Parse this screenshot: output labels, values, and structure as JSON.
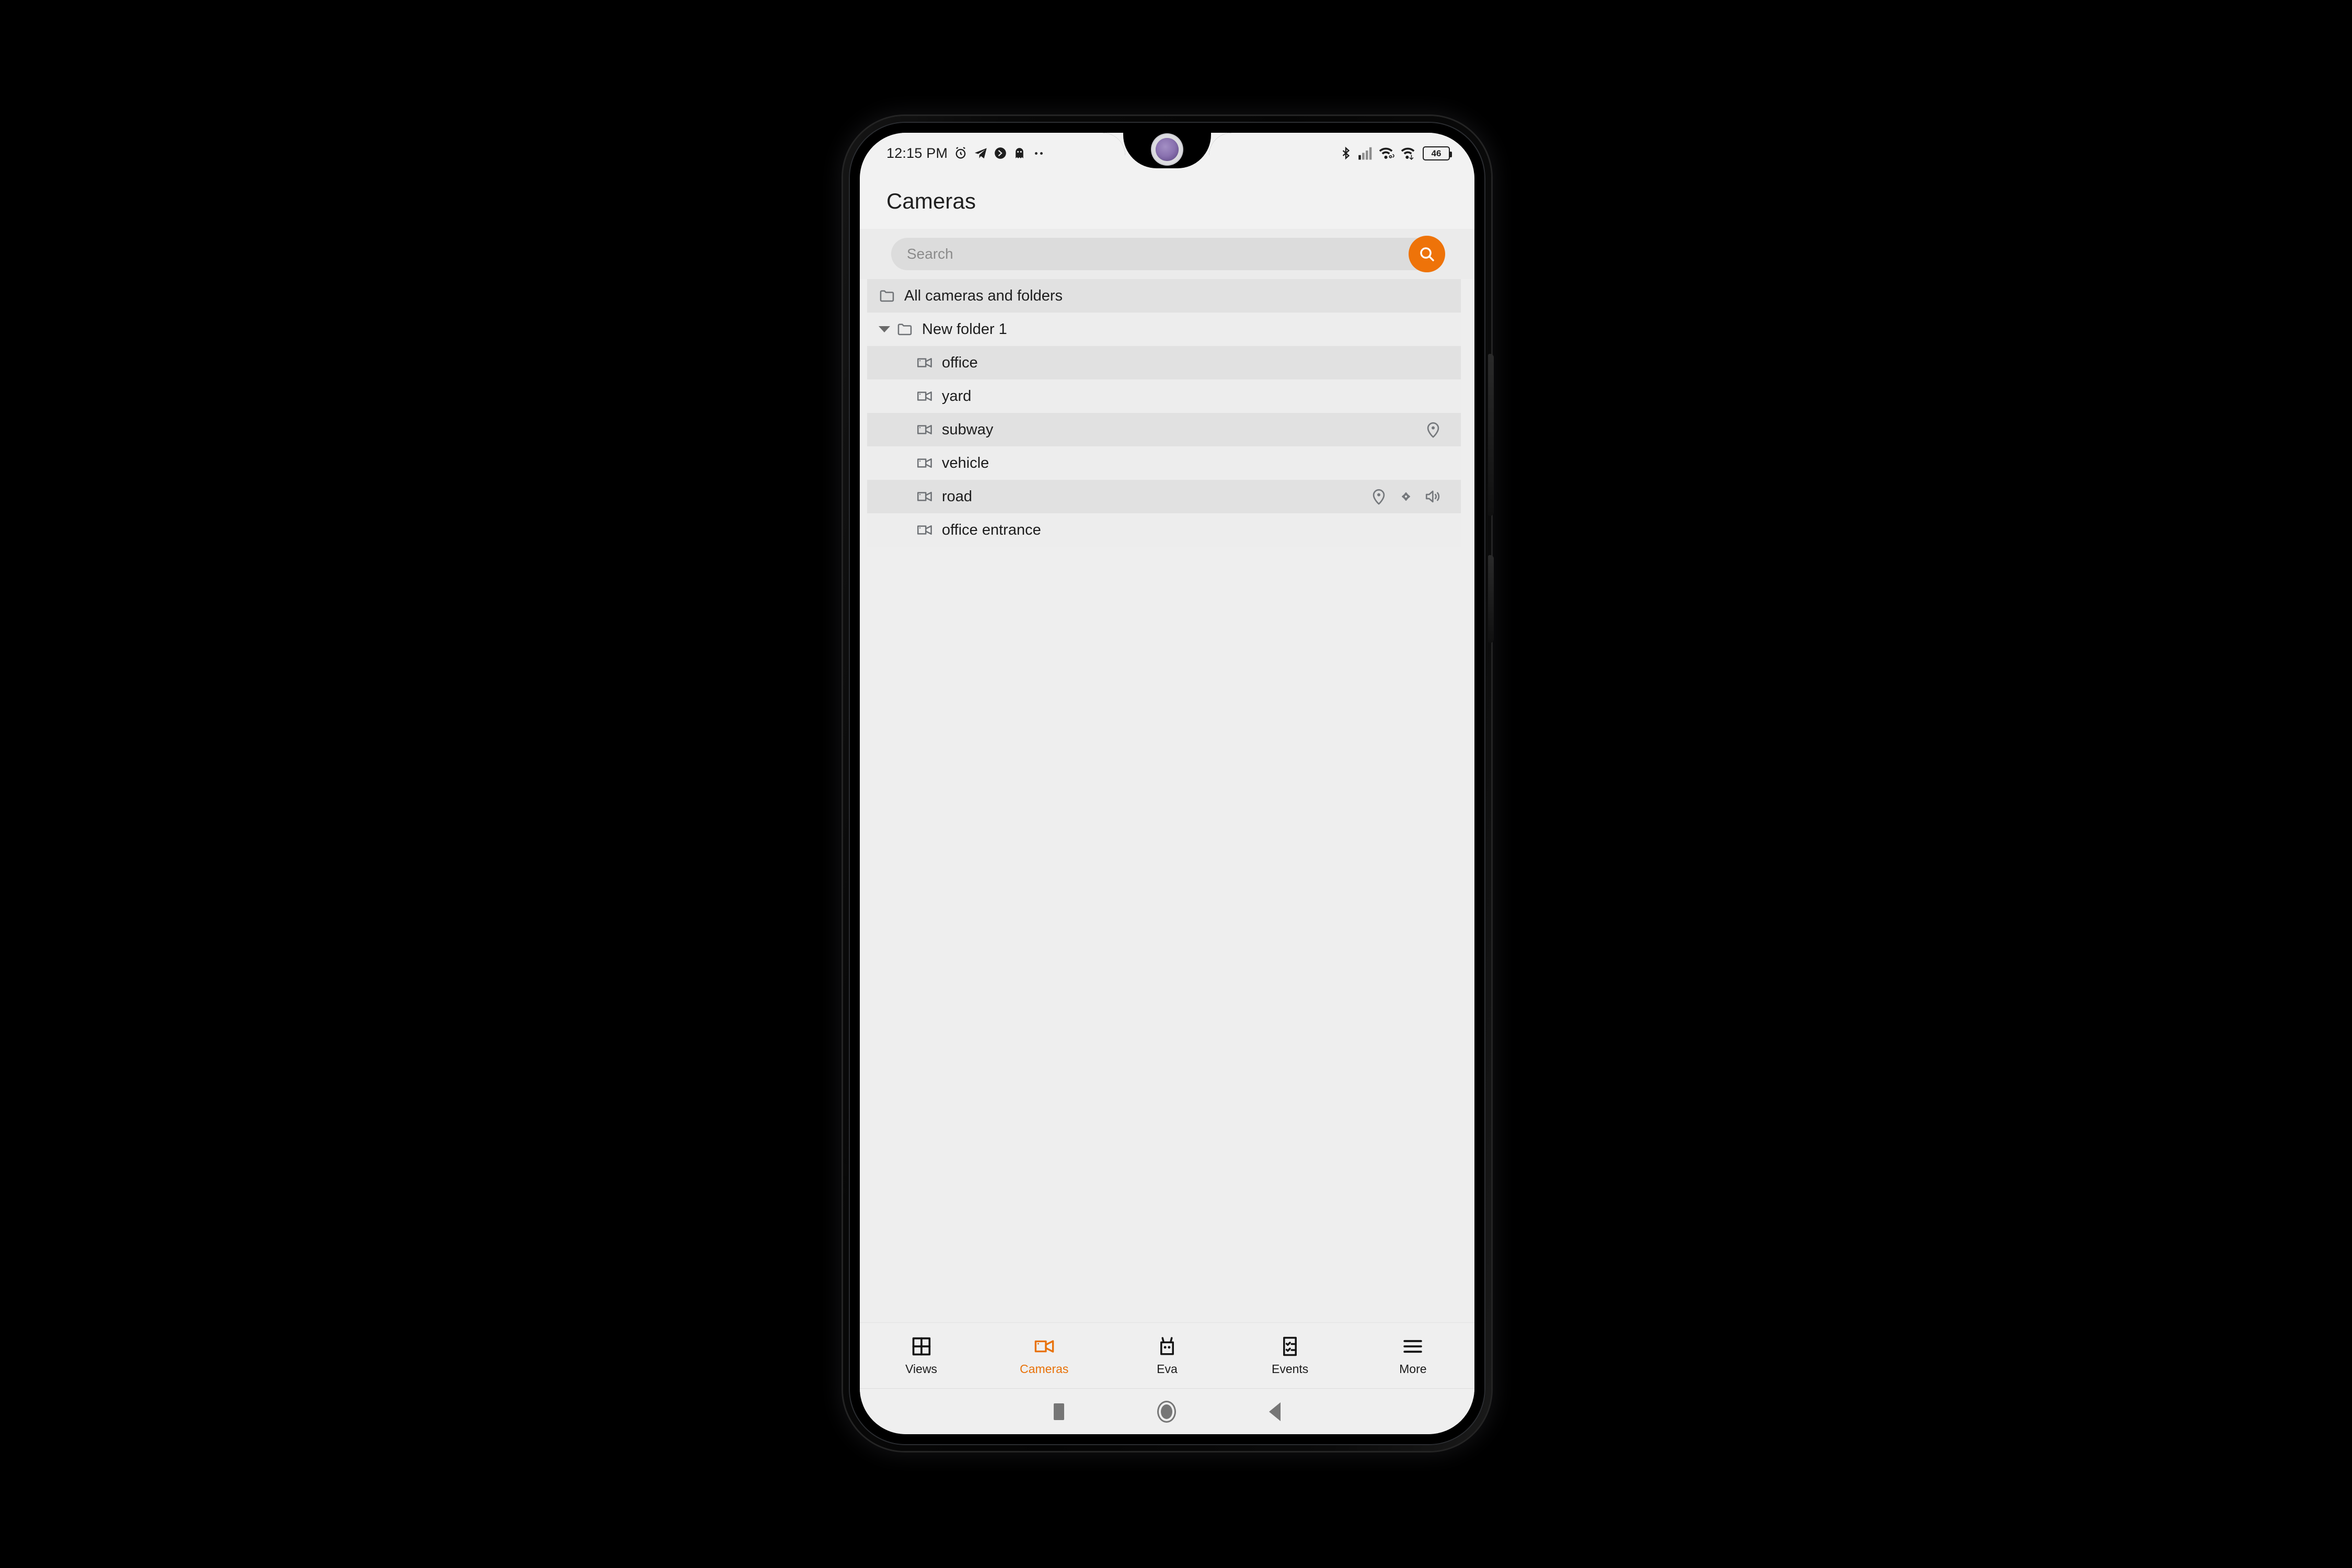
{
  "status_bar": {
    "time": "12:15 PM",
    "left_icons": [
      "alarm-clock-icon",
      "telegram-icon",
      "chevron-circle-icon",
      "ghost-icon",
      "ellipsis-icon"
    ],
    "right_icons": [
      "bluetooth-icon",
      "cellular-signal-icon",
      "wifi-link-icon",
      "wifi-transfer-icon"
    ],
    "battery_level": "46"
  },
  "header": {
    "title": "Cameras"
  },
  "search": {
    "placeholder": "Search",
    "value": "",
    "button_icon": "search-icon",
    "button_color": "#ee7309"
  },
  "list": {
    "rows": [
      {
        "label": "All cameras and folders",
        "icon": "folder-icon",
        "indent": 0,
        "shade": "dark",
        "expandable": false,
        "actions": []
      },
      {
        "label": "New folder 1",
        "icon": "folder-icon",
        "indent": 1,
        "shade": "light",
        "expandable": true,
        "actions": []
      },
      {
        "label": "office",
        "icon": "video-camera-icon",
        "indent": 2,
        "shade": "dark",
        "expandable": false,
        "actions": []
      },
      {
        "label": "yard",
        "icon": "video-camera-icon",
        "indent": 2,
        "shade": "light",
        "expandable": false,
        "actions": []
      },
      {
        "label": "subway",
        "icon": "video-camera-icon",
        "indent": 2,
        "shade": "dark",
        "expandable": false,
        "actions": [
          "location-pin-icon"
        ]
      },
      {
        "label": "vehicle",
        "icon": "video-camera-icon",
        "indent": 2,
        "shade": "light",
        "expandable": false,
        "actions": []
      },
      {
        "label": "road",
        "icon": "video-camera-icon",
        "indent": 2,
        "shade": "dark",
        "expandable": false,
        "actions": [
          "location-pin-icon",
          "ptz-control-icon",
          "speaker-icon"
        ]
      },
      {
        "label": "office entrance",
        "icon": "video-camera-icon",
        "indent": 2,
        "shade": "light",
        "expandable": false,
        "actions": []
      }
    ]
  },
  "tab_bar": {
    "active": "Cameras",
    "active_color": "#e87209",
    "items": [
      {
        "label": "Views",
        "icon": "grid-icon"
      },
      {
        "label": "Cameras",
        "icon": "video-camera-icon"
      },
      {
        "label": "Eva",
        "icon": "robot-icon"
      },
      {
        "label": "Events",
        "icon": "checklist-icon"
      },
      {
        "label": "More",
        "icon": "hamburger-menu-icon"
      }
    ]
  },
  "android_nav": {
    "items": [
      "recents-button",
      "home-button",
      "back-button"
    ]
  }
}
